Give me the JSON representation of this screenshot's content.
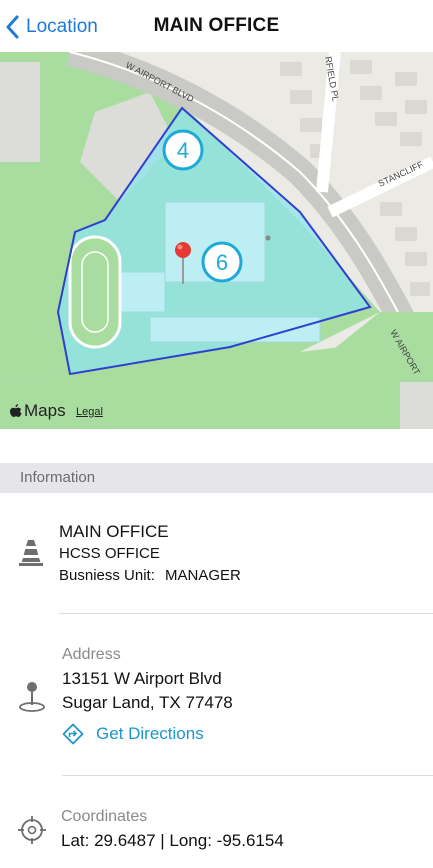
{
  "nav": {
    "back_label": "Location",
    "title": "MAIN OFFICE"
  },
  "map": {
    "streets": [
      "W AIRPORT BLVD",
      "W AIRPORT",
      "STANCLIFF",
      "RFIELD PL"
    ],
    "zone_labels": [
      "4",
      "6"
    ],
    "attribution": {
      "logo": "Maps",
      "legal": "Legal"
    }
  },
  "information": {
    "section_title": "Information",
    "name": "MAIN OFFICE",
    "subtitle": "HCSS OFFICE",
    "business_unit_label": "Busniess Unit:",
    "business_unit_value": "MANAGER"
  },
  "address": {
    "label": "Address",
    "line1": "13151 W Airport Blvd",
    "line2": "Sugar Land, TX 77478",
    "directions_label": "Get Directions"
  },
  "coordinates": {
    "label": "Coordinates",
    "value": "Lat: 29.6487 | Long: -95.6154"
  },
  "colors": {
    "accent": "#1f7ad6",
    "link": "#1e96c8",
    "boundary": "#2f3fd0",
    "zone_fill": "#8fe3ec",
    "pin": "#e53935"
  }
}
